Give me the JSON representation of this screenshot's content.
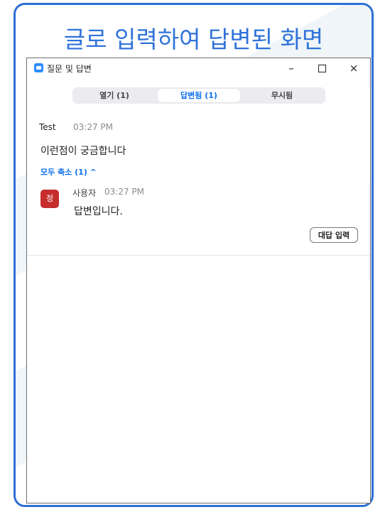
{
  "frame_title": "글로 입력하여 답변된 화면",
  "window": {
    "title": "질문 및 답변",
    "controls": {
      "minimize": "–",
      "close": "×"
    }
  },
  "tabs": [
    {
      "label": "열기 (1)",
      "active": false
    },
    {
      "label": "답변됨 (1)",
      "active": true
    },
    {
      "label": "무시됨",
      "active": false
    }
  ],
  "question": {
    "author": "Test",
    "time": "03:27 PM",
    "text": "이런점이 궁금합니다",
    "collapse_label": "모두 축소 (1) ^"
  },
  "answer": {
    "avatar_initial": "정",
    "author": "사용자",
    "time": "03:27 PM",
    "text": "답변입니다."
  },
  "reply_button": "대답 입력",
  "colors": {
    "frame_border": "#2f6fd6",
    "accent": "#0e71eb",
    "avatar_bg": "#c62e2e",
    "app_icon": "#2d8cff"
  },
  "icons": [
    "zoom-app-icon",
    "minimize-icon",
    "maximize-icon",
    "close-icon",
    "chevron-up-icon"
  ]
}
